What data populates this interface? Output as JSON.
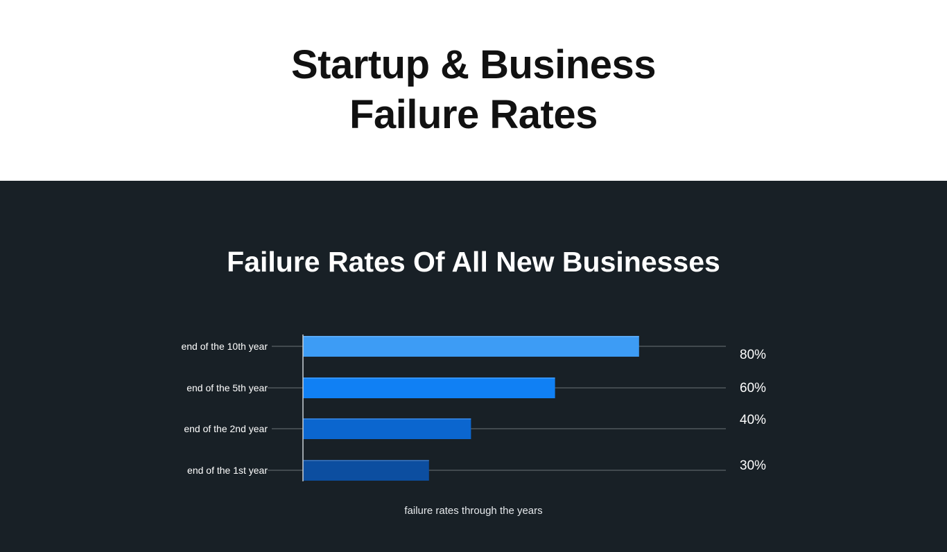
{
  "header": {
    "title_line1": "Startup & Business",
    "title_line2": "Failure Rates"
  },
  "colors": {
    "dark_background": "#182026",
    "gridline": "#6b7378",
    "axis": "#c9d0d6",
    "text_light": "#ffffff"
  },
  "chart_data": {
    "type": "bar",
    "orientation": "horizontal",
    "title": "Failure Rates Of All New Businesses",
    "xlabel": "failure rates through the years",
    "ylabel": "",
    "categories": [
      "end of the 10th year",
      "end of the 5th year",
      "end of the 2nd year",
      "end of the 1st year"
    ],
    "values": [
      80,
      60,
      40,
      30
    ],
    "value_labels": [
      "80%",
      "60%",
      "40%",
      "30%"
    ],
    "bar_colors": [
      "#3d9cf5",
      "#1080f4",
      "#0b66cf",
      "#0c4ea0"
    ],
    "xlim": [
      0,
      100
    ],
    "grid": true,
    "legend": "none"
  }
}
